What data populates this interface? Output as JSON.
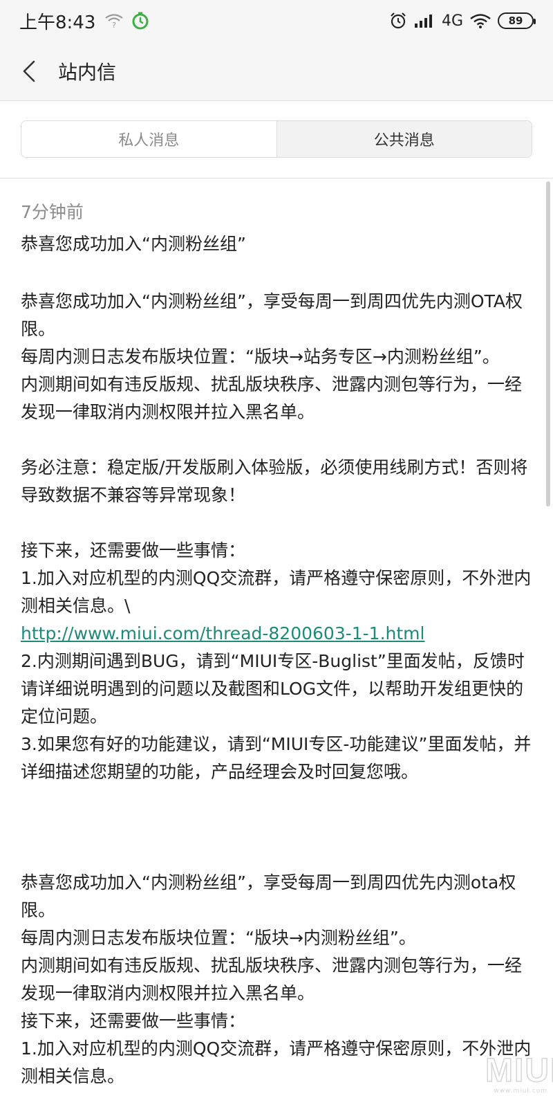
{
  "status_bar": {
    "time": "上午8:43",
    "network": "4G",
    "battery": "89",
    "icons": [
      "wifi-question-icon",
      "timer-icon",
      "alarm-icon",
      "signal-icon",
      "wifi-icon",
      "battery-icon"
    ]
  },
  "header": {
    "title": "站内信",
    "back_icon": "chevron-left-icon"
  },
  "tabs": [
    {
      "label": "私人消息",
      "active": false
    },
    {
      "label": "公共消息",
      "active": true
    }
  ],
  "message": {
    "time": "7分钟前",
    "title": "恭喜您成功加入“内测粉丝组”",
    "body": {
      "p1": "恭喜您成功加入“内测粉丝组”，享受每周一到周四优先内测OTA权限。",
      "p2": "每周内测日志发布版块位置：“版块→站务专区→内测粉丝组”。",
      "p3": "内测期间如有违反版规、扰乱版块秩序、泄露内测包等行为，一经发现一律取消内测权限并拉入黑名单。",
      "p4": "务必注意：稳定版/开发版刷入体验版，必须使用线刷方式！否则将导致数据不兼容等异常现象！",
      "p5": "接下来，还需要做一些事情：",
      "p6": "1.加入对应机型的内测QQ交流群，请严格遵守保密原则，不外泄内测相关信息。\\",
      "link": "http://www.miui.com/thread-8200603-1-1.html",
      "p7": "2.内测期间遇到BUG，请到“MIUI专区-Buglist”里面发帖，反馈时请详细说明遇到的问题以及截图和LOG文件，以帮助开发组更快的定位问题。",
      "p8": "3.如果您有好的功能建议，请到“MIUI专区-功能建议”里面发帖，并详细描述您期望的功能，产品经理会及时回复您哦。",
      "p9": "恭喜您成功加入“内测粉丝组”，享受每周一到周四优先内测ota权限。",
      "p10": "每周内测日志发布版块位置：“版块→内测粉丝组”。",
      "p11": "内测期间如有违反版规、扰乱版块秩序、泄露内测包等行为，一经发现一律取消内测权限并拉入黑名单。",
      "p12": "接下来，还需要做一些事情：",
      "p13": "1.加入对应机型的内测QQ交流群，请严格遵守保密原则，不外泄内测相关信息。"
    }
  },
  "watermark": {
    "brand": "MIUI",
    "site": "www.miui.com"
  },
  "colors": {
    "link": "#1d8a7a",
    "bar_bg": "#f6f6f6",
    "muted_text": "#8c8c8c"
  }
}
